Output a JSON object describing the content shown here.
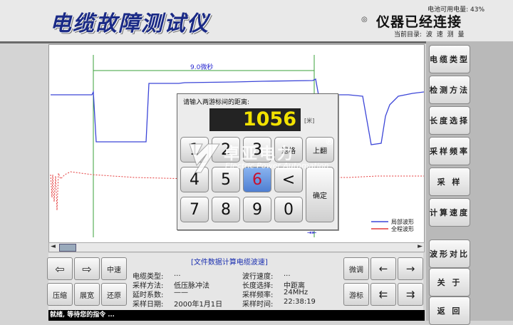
{
  "header": {
    "title": "电缆故障测试仪",
    "battery": "电池可用电量: 43%",
    "connection": "仪器已经连接",
    "current_dir": "当前目录: 波 速 测 量"
  },
  "plot": {
    "cursor_span": "9.0微秒",
    "legend": [
      "局部波形",
      "全程波形"
    ],
    "colors": {
      "local": "#3c46d8",
      "full": "#e43a3a",
      "cursor": "#3aa03a"
    }
  },
  "right_menu": [
    "电缆类型",
    "检测方法",
    "长度选择",
    "采样频率",
    "采 样",
    "计算速度",
    "波形对比",
    "关 于",
    "返 回"
  ],
  "bottom": {
    "left_buttons": [
      "⇦",
      "⇨",
      "中速",
      "压缩",
      "展宽",
      "还原"
    ],
    "right_buttons": [
      "微调",
      "←",
      "→",
      "游标",
      "⇇",
      "⇉"
    ],
    "info_title": "[文件数据计算电缆波速]",
    "info": [
      [
        "电缆类型:",
        "..."
      ],
      [
        "采样方法:",
        "低压脉冲法"
      ],
      [
        "延时系数:",
        "——"
      ],
      [
        "采样日期:",
        "2000年1月1日"
      ],
      [
        "波行速度:",
        "..."
      ],
      [
        "长度选择:",
        "中距离"
      ],
      [
        "采样频率:",
        "24MHz"
      ],
      [
        "采样时间:",
        "22:38:19"
      ]
    ]
  },
  "status": "就绪, 等待您的指令 ...",
  "dialog": {
    "prompt": "请输入两游标间的距离:",
    "value": "1056",
    "unit": "[米]",
    "keys": [
      "1",
      "2",
      "3",
      "退格",
      "上翻",
      "4",
      "5",
      "6",
      "<",
      "7",
      "8",
      "9",
      "0",
      "确定"
    ]
  },
  "watermark": {
    "name": "卓亚电力",
    "english": "Electric Power Automation",
    "reg": "®"
  }
}
